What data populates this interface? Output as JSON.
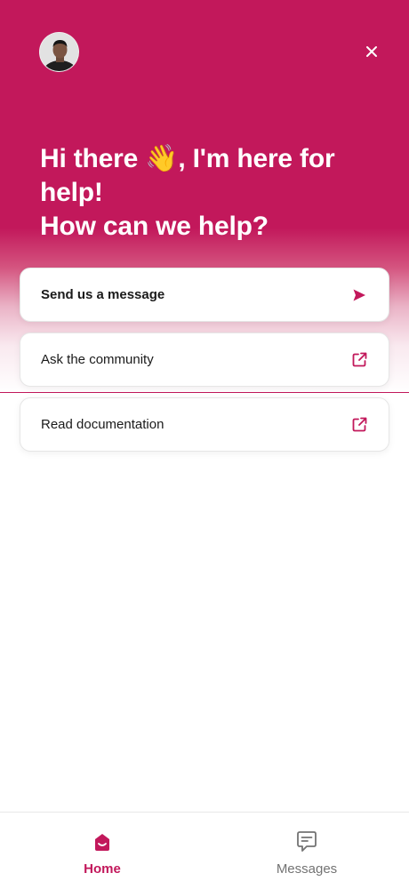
{
  "colors": {
    "brand": "#c2185b",
    "icon_gray": "#737373"
  },
  "header": {
    "greeting_lines": [
      "Hi there 👋, I'm here for",
      "help!",
      "How can we help?"
    ]
  },
  "cards": [
    {
      "label": "Send us a message",
      "icon": "send-icon"
    },
    {
      "label": "Ask the community",
      "icon": "external-link-icon"
    },
    {
      "label": "Read documentation",
      "icon": "external-link-icon"
    }
  ],
  "tabs": [
    {
      "label": "Home",
      "icon": "home-icon",
      "active": true
    },
    {
      "label": "Messages",
      "icon": "messages-icon",
      "active": false
    }
  ]
}
